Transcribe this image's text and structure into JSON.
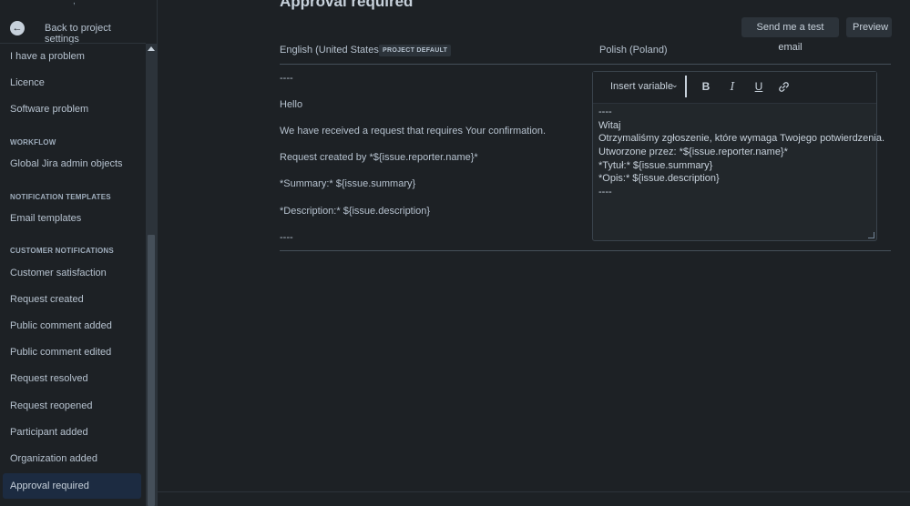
{
  "sidebar": {
    "back_label": "Back to project settings",
    "items_top": [
      {
        "label": "I have a problem"
      },
      {
        "label": "Licence"
      },
      {
        "label": "Software problem"
      }
    ],
    "sections": [
      {
        "title": "WORKFLOW",
        "items": [
          "Global Jira admin objects"
        ]
      },
      {
        "title": "NOTIFICATION TEMPLATES",
        "items": [
          "Email templates"
        ]
      },
      {
        "title": "CUSTOMER NOTIFICATIONS",
        "items": [
          "Customer satisfaction",
          "Request created",
          "Public comment added",
          "Public comment edited",
          "Request resolved",
          "Request reopened",
          "Participant added",
          "Organization added",
          "Approval required"
        ]
      }
    ],
    "active_item": "Approval required"
  },
  "page": {
    "title": "Approval required",
    "test_email_button": "Send me a test email",
    "preview_button": "Preview"
  },
  "english": {
    "language": "English (United States)",
    "badge": "PROJECT DEFAULT",
    "lines": [
      "----",
      "Hello",
      "We have received a request that requires Your confirmation.",
      "Request created by *${issue.reporter.name}*",
      "*Summary:* ${issue.summary}",
      "*Description:*  ${issue.description}",
      "----"
    ]
  },
  "polish": {
    "language": "Polish (Poland)",
    "insert_variable": "Insert variable",
    "bold": "B",
    "italic": "I",
    "underline": "U",
    "lines": [
      "----",
      "Witaj",
      "Otrzymaliśmy zgłoszenie, które wymaga Twojego potwierdzenia.",
      "Utworzone przez: *${issue.reporter.name}*",
      "*Tytuł:* ${issue.summary}",
      "*Opis:*  ${issue.description}",
      "----"
    ]
  },
  "icons": {
    "back": "arrow-left-circle-icon",
    "chevron": "chevron-down-icon",
    "link": "link-icon"
  },
  "colors": {
    "background": "#1d2125",
    "text": "#b6c2cf",
    "active_item_bg": "#1c2b41",
    "button_bg": "#2c333a"
  }
}
